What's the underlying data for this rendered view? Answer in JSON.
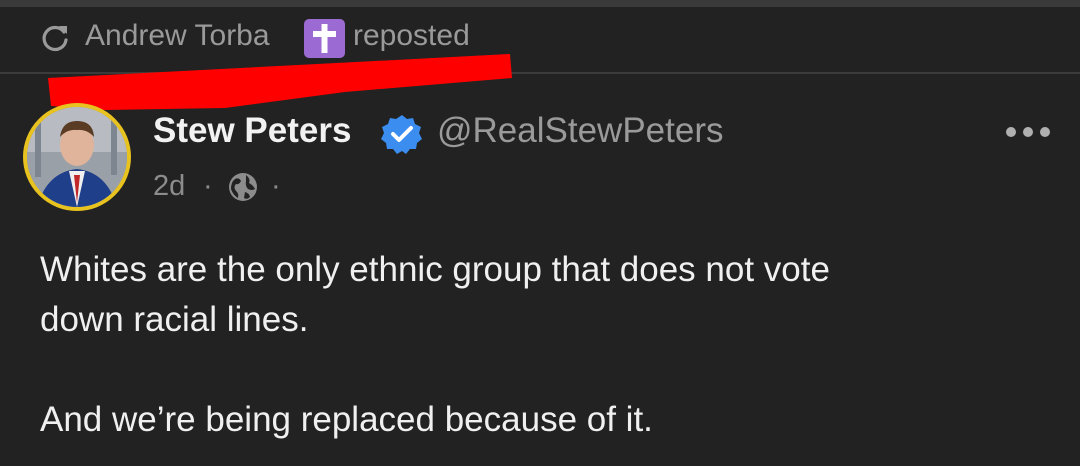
{
  "repost": {
    "user": "Andrew Torba",
    "label": "reposted",
    "badge_color": "#9b6bd3"
  },
  "post": {
    "author": {
      "display_name": "Stew Peters",
      "handle": "@RealStewPeters",
      "verified": true,
      "avatar_ring_color": "#e8c21e"
    },
    "time": "2d",
    "separator": "·",
    "visibility_icon": "globe-icon",
    "text": {
      "line1": "Whites are the only ethnic group that does not vote",
      "line2": "down racial lines.",
      "line3": "And we’re being replaced because of it."
    }
  },
  "colors": {
    "background": "#222222",
    "redaction": "#ff0000",
    "verified": "#3b8df0"
  }
}
